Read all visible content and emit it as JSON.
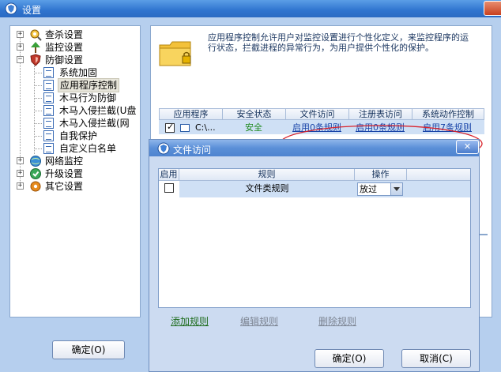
{
  "main_window": {
    "title": "设置",
    "ok_button": "确定(O)"
  },
  "tree": {
    "nodes": [
      {
        "label": "查杀设置",
        "icon": "scan-icon",
        "expander": "+"
      },
      {
        "label": "监控设置",
        "icon": "monitor-icon",
        "expander": "+"
      },
      {
        "label": "防御设置",
        "icon": "shield-icon",
        "expander": "−"
      },
      {
        "label": "系统加固",
        "icon": "doc-icon"
      },
      {
        "label": "应用程序控制",
        "icon": "doc-icon",
        "selected": true
      },
      {
        "label": "木马行为防御",
        "icon": "doc-icon"
      },
      {
        "label": "木马入侵拦截(U盘",
        "icon": "doc-icon"
      },
      {
        "label": "木马入侵拦截(网",
        "icon": "doc-icon"
      },
      {
        "label": "自我保护",
        "icon": "doc-icon"
      },
      {
        "label": "自定义白名单",
        "icon": "doc-icon"
      },
      {
        "label": "网络监控",
        "icon": "network-icon",
        "expander": "+"
      },
      {
        "label": "升级设置",
        "icon": "upgrade-icon",
        "expander": "+"
      },
      {
        "label": "其它设置",
        "icon": "gear-icon",
        "expander": "+"
      }
    ]
  },
  "content": {
    "description": "应用程序控制允许用户对监控设置进行个性化定义，来监控程序的运行状态，拦截进程的异常行为，为用户提供个性化的保护。",
    "table": {
      "headers": [
        "应用程序",
        "安全状态",
        "文件访问",
        "注册表访问",
        "系统动作控制"
      ],
      "rows": [
        {
          "app": "C:\\...",
          "status": "安全",
          "file": "启用0条规则",
          "registry": "启用0条规则",
          "system": "启用7条规则",
          "checked": true
        }
      ]
    },
    "highlight_color": "#d9222b"
  },
  "dialog": {
    "title": "文件访问",
    "close_label": "✕",
    "list_headers": [
      "启用",
      "规则",
      "操作"
    ],
    "rows": [
      {
        "enabled": false,
        "rule": "文件类规则",
        "action": "放过"
      }
    ],
    "add_rule": "添加规则",
    "edit_rule": "编辑规则",
    "delete_rule": "删除规则",
    "ok_button": "确定(O)",
    "cancel_button": "取消(C)"
  }
}
